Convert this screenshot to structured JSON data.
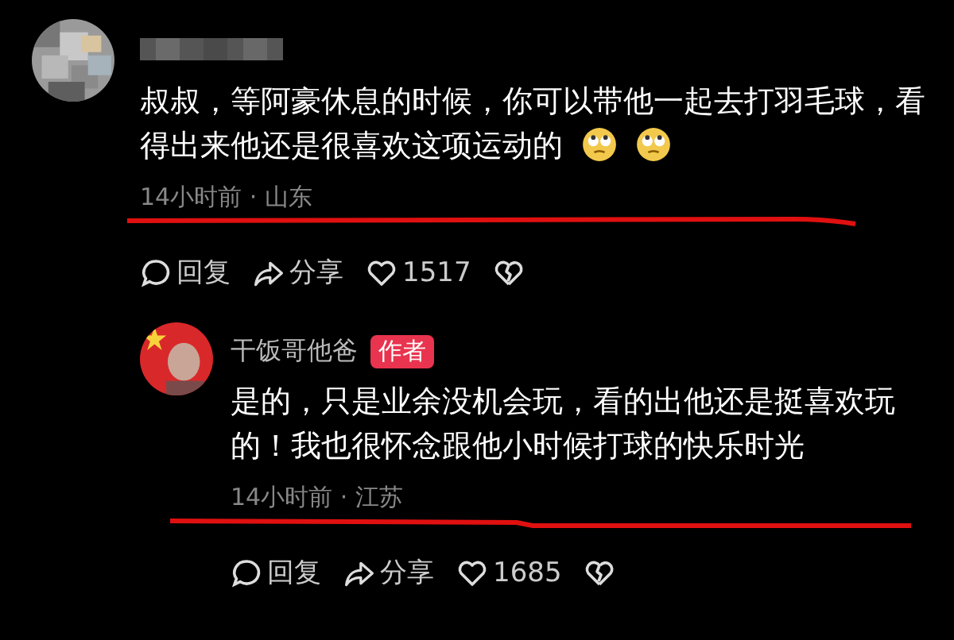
{
  "comments": [
    {
      "avatar": {
        "kind": "pixelated"
      },
      "name_hidden": true,
      "text": "叔叔，等阿豪休息的时候，你可以带他一起去打羽毛球，看得出来他还是很喜欢这项运动的",
      "emojis": [
        {
          "kind": "eyeroll"
        },
        {
          "kind": "eyeroll"
        }
      ],
      "meta": "14小时前 · 山东",
      "marked": true,
      "actions": [
        {
          "kind": "reply",
          "label": "回复"
        },
        {
          "kind": "share",
          "label": "分享"
        },
        {
          "kind": "like",
          "label": "1517"
        },
        {
          "kind": "dislike"
        }
      ],
      "replies": [
        {
          "avatar": {
            "kind": "flag"
          },
          "name_hidden": false,
          "author": "干饭哥他爸",
          "badge": "作者",
          "text": "是的，只是业余没机会玩，看的出他还是挺喜欢玩的！我也很怀念跟他小时候打球的快乐时光",
          "meta": "14小时前 · 江苏",
          "marked": true,
          "actions": [
            {
              "kind": "reply",
              "label": "回复"
            },
            {
              "kind": "share",
              "label": "分享"
            },
            {
              "kind": "like",
              "label": "1685"
            },
            {
              "kind": "dislike"
            }
          ]
        }
      ]
    }
  ]
}
